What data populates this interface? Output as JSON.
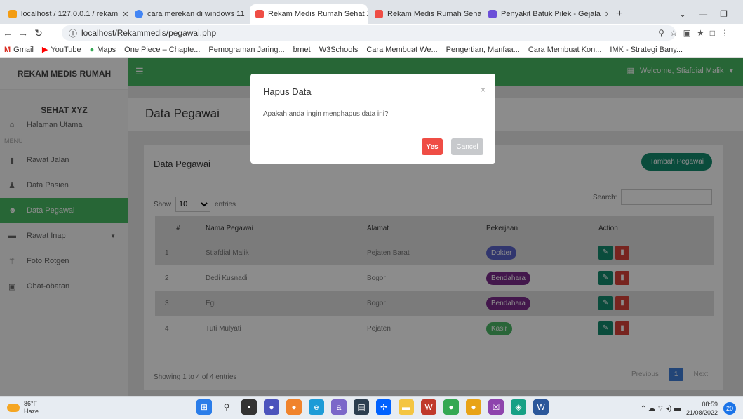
{
  "browser": {
    "tabs": [
      {
        "title": "localhost / 127.0.0.1 / rekam"
      },
      {
        "title": "cara merekan di windows 11"
      },
      {
        "title": "Rekam Medis Rumah Sehat X"
      },
      {
        "title": "Rekam Medis Rumah Sehat X"
      },
      {
        "title": "Penyakit Batuk Pilek - Gejala"
      }
    ],
    "url": "localhost/Rekammedis/pegawai.php",
    "bookmarks": [
      "Gmail",
      "YouTube",
      "Maps",
      "One Piece – Chapte...",
      "Pemograman Jaring...",
      "brnet",
      "W3Schools",
      "Cara Membuat We...",
      "Pengertian, Manfaa...",
      "Cara Membuat Kon...",
      "IMK - Strategi Bany..."
    ]
  },
  "sidebar": {
    "brand": "REKAM MEDIS RUMAH",
    "brand_sub": "SEHAT XYZ",
    "home": "Halaman Utama",
    "menu_label": "MENU",
    "items": [
      {
        "label": "Rawat Jalan"
      },
      {
        "label": "Data Pasien"
      },
      {
        "label": "Data Pegawai"
      },
      {
        "label": "Rawat Inap"
      },
      {
        "label": "Foto Rotgen"
      },
      {
        "label": "Obat-obatan"
      }
    ]
  },
  "topbar": {
    "welcome": "Welcome, Stiafdial Malik"
  },
  "page": {
    "title": "Data Pegawai"
  },
  "card": {
    "title": "Data Pegawai",
    "add_button": "Tambah Pegawai",
    "show_label": "Show",
    "entries_value": "10",
    "entries_label": "entries",
    "search_label": "Search:",
    "columns": [
      "#",
      "Nama Pegawai",
      "Alamat",
      "Pekerjaan",
      "Action"
    ],
    "rows": [
      {
        "no": "1",
        "nama": "Stiafdial Malik",
        "alamat": "Pejaten Barat",
        "pekerjaan": "Dokter",
        "color": "#5a63c9"
      },
      {
        "no": "2",
        "nama": "Dedi Kusnadi",
        "alamat": "Bogor",
        "pekerjaan": "Bendahara",
        "color": "#7a2a8a"
      },
      {
        "no": "3",
        "nama": "Egi",
        "alamat": "Bogor",
        "pekerjaan": "Bendahara",
        "color": "#7a2a8a"
      },
      {
        "no": "4",
        "nama": "Tuti Mulyati",
        "alamat": "Pejaten",
        "pekerjaan": "Kasir",
        "color": "#4cb866"
      }
    ],
    "info": "Showing 1 to 4 of 4 entries",
    "prev": "Previous",
    "page": "1",
    "next": "Next"
  },
  "modal": {
    "title": "Hapus Data",
    "close": "×",
    "message": "Apakah anda ingin menghapus data ini?",
    "yes": "Yes",
    "cancel": "Cancel"
  },
  "taskbar": {
    "temp": "86°F",
    "weather": "Haze",
    "time": "08:59",
    "date": "21/08/2022",
    "notif": "20"
  }
}
